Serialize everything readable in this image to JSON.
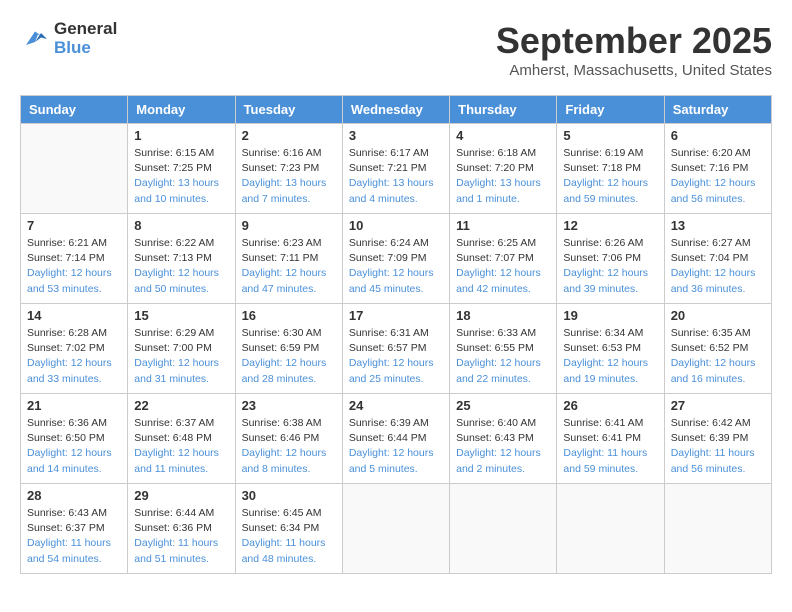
{
  "logo": {
    "line1": "General",
    "line2": "Blue"
  },
  "title": "September 2025",
  "location": "Amherst, Massachusetts, United States",
  "weekdays": [
    "Sunday",
    "Monday",
    "Tuesday",
    "Wednesday",
    "Thursday",
    "Friday",
    "Saturday"
  ],
  "weeks": [
    [
      {
        "num": "",
        "sunrise": "",
        "sunset": "",
        "daylight": ""
      },
      {
        "num": "1",
        "sunrise": "Sunrise: 6:15 AM",
        "sunset": "Sunset: 7:25 PM",
        "daylight": "Daylight: 13 hours and 10 minutes."
      },
      {
        "num": "2",
        "sunrise": "Sunrise: 6:16 AM",
        "sunset": "Sunset: 7:23 PM",
        "daylight": "Daylight: 13 hours and 7 minutes."
      },
      {
        "num": "3",
        "sunrise": "Sunrise: 6:17 AM",
        "sunset": "Sunset: 7:21 PM",
        "daylight": "Daylight: 13 hours and 4 minutes."
      },
      {
        "num": "4",
        "sunrise": "Sunrise: 6:18 AM",
        "sunset": "Sunset: 7:20 PM",
        "daylight": "Daylight: 13 hours and 1 minute."
      },
      {
        "num": "5",
        "sunrise": "Sunrise: 6:19 AM",
        "sunset": "Sunset: 7:18 PM",
        "daylight": "Daylight: 12 hours and 59 minutes."
      },
      {
        "num": "6",
        "sunrise": "Sunrise: 6:20 AM",
        "sunset": "Sunset: 7:16 PM",
        "daylight": "Daylight: 12 hours and 56 minutes."
      }
    ],
    [
      {
        "num": "7",
        "sunrise": "Sunrise: 6:21 AM",
        "sunset": "Sunset: 7:14 PM",
        "daylight": "Daylight: 12 hours and 53 minutes."
      },
      {
        "num": "8",
        "sunrise": "Sunrise: 6:22 AM",
        "sunset": "Sunset: 7:13 PM",
        "daylight": "Daylight: 12 hours and 50 minutes."
      },
      {
        "num": "9",
        "sunrise": "Sunrise: 6:23 AM",
        "sunset": "Sunset: 7:11 PM",
        "daylight": "Daylight: 12 hours and 47 minutes."
      },
      {
        "num": "10",
        "sunrise": "Sunrise: 6:24 AM",
        "sunset": "Sunset: 7:09 PM",
        "daylight": "Daylight: 12 hours and 45 minutes."
      },
      {
        "num": "11",
        "sunrise": "Sunrise: 6:25 AM",
        "sunset": "Sunset: 7:07 PM",
        "daylight": "Daylight: 12 hours and 42 minutes."
      },
      {
        "num": "12",
        "sunrise": "Sunrise: 6:26 AM",
        "sunset": "Sunset: 7:06 PM",
        "daylight": "Daylight: 12 hours and 39 minutes."
      },
      {
        "num": "13",
        "sunrise": "Sunrise: 6:27 AM",
        "sunset": "Sunset: 7:04 PM",
        "daylight": "Daylight: 12 hours and 36 minutes."
      }
    ],
    [
      {
        "num": "14",
        "sunrise": "Sunrise: 6:28 AM",
        "sunset": "Sunset: 7:02 PM",
        "daylight": "Daylight: 12 hours and 33 minutes."
      },
      {
        "num": "15",
        "sunrise": "Sunrise: 6:29 AM",
        "sunset": "Sunset: 7:00 PM",
        "daylight": "Daylight: 12 hours and 31 minutes."
      },
      {
        "num": "16",
        "sunrise": "Sunrise: 6:30 AM",
        "sunset": "Sunset: 6:59 PM",
        "daylight": "Daylight: 12 hours and 28 minutes."
      },
      {
        "num": "17",
        "sunrise": "Sunrise: 6:31 AM",
        "sunset": "Sunset: 6:57 PM",
        "daylight": "Daylight: 12 hours and 25 minutes."
      },
      {
        "num": "18",
        "sunrise": "Sunrise: 6:33 AM",
        "sunset": "Sunset: 6:55 PM",
        "daylight": "Daylight: 12 hours and 22 minutes."
      },
      {
        "num": "19",
        "sunrise": "Sunrise: 6:34 AM",
        "sunset": "Sunset: 6:53 PM",
        "daylight": "Daylight: 12 hours and 19 minutes."
      },
      {
        "num": "20",
        "sunrise": "Sunrise: 6:35 AM",
        "sunset": "Sunset: 6:52 PM",
        "daylight": "Daylight: 12 hours and 16 minutes."
      }
    ],
    [
      {
        "num": "21",
        "sunrise": "Sunrise: 6:36 AM",
        "sunset": "Sunset: 6:50 PM",
        "daylight": "Daylight: 12 hours and 14 minutes."
      },
      {
        "num": "22",
        "sunrise": "Sunrise: 6:37 AM",
        "sunset": "Sunset: 6:48 PM",
        "daylight": "Daylight: 12 hours and 11 minutes."
      },
      {
        "num": "23",
        "sunrise": "Sunrise: 6:38 AM",
        "sunset": "Sunset: 6:46 PM",
        "daylight": "Daylight: 12 hours and 8 minutes."
      },
      {
        "num": "24",
        "sunrise": "Sunrise: 6:39 AM",
        "sunset": "Sunset: 6:44 PM",
        "daylight": "Daylight: 12 hours and 5 minutes."
      },
      {
        "num": "25",
        "sunrise": "Sunrise: 6:40 AM",
        "sunset": "Sunset: 6:43 PM",
        "daylight": "Daylight: 12 hours and 2 minutes."
      },
      {
        "num": "26",
        "sunrise": "Sunrise: 6:41 AM",
        "sunset": "Sunset: 6:41 PM",
        "daylight": "Daylight: 11 hours and 59 minutes."
      },
      {
        "num": "27",
        "sunrise": "Sunrise: 6:42 AM",
        "sunset": "Sunset: 6:39 PM",
        "daylight": "Daylight: 11 hours and 56 minutes."
      }
    ],
    [
      {
        "num": "28",
        "sunrise": "Sunrise: 6:43 AM",
        "sunset": "Sunset: 6:37 PM",
        "daylight": "Daylight: 11 hours and 54 minutes."
      },
      {
        "num": "29",
        "sunrise": "Sunrise: 6:44 AM",
        "sunset": "Sunset: 6:36 PM",
        "daylight": "Daylight: 11 hours and 51 minutes."
      },
      {
        "num": "30",
        "sunrise": "Sunrise: 6:45 AM",
        "sunset": "Sunset: 6:34 PM",
        "daylight": "Daylight: 11 hours and 48 minutes."
      },
      {
        "num": "",
        "sunrise": "",
        "sunset": "",
        "daylight": ""
      },
      {
        "num": "",
        "sunrise": "",
        "sunset": "",
        "daylight": ""
      },
      {
        "num": "",
        "sunrise": "",
        "sunset": "",
        "daylight": ""
      },
      {
        "num": "",
        "sunrise": "",
        "sunset": "",
        "daylight": ""
      }
    ]
  ]
}
